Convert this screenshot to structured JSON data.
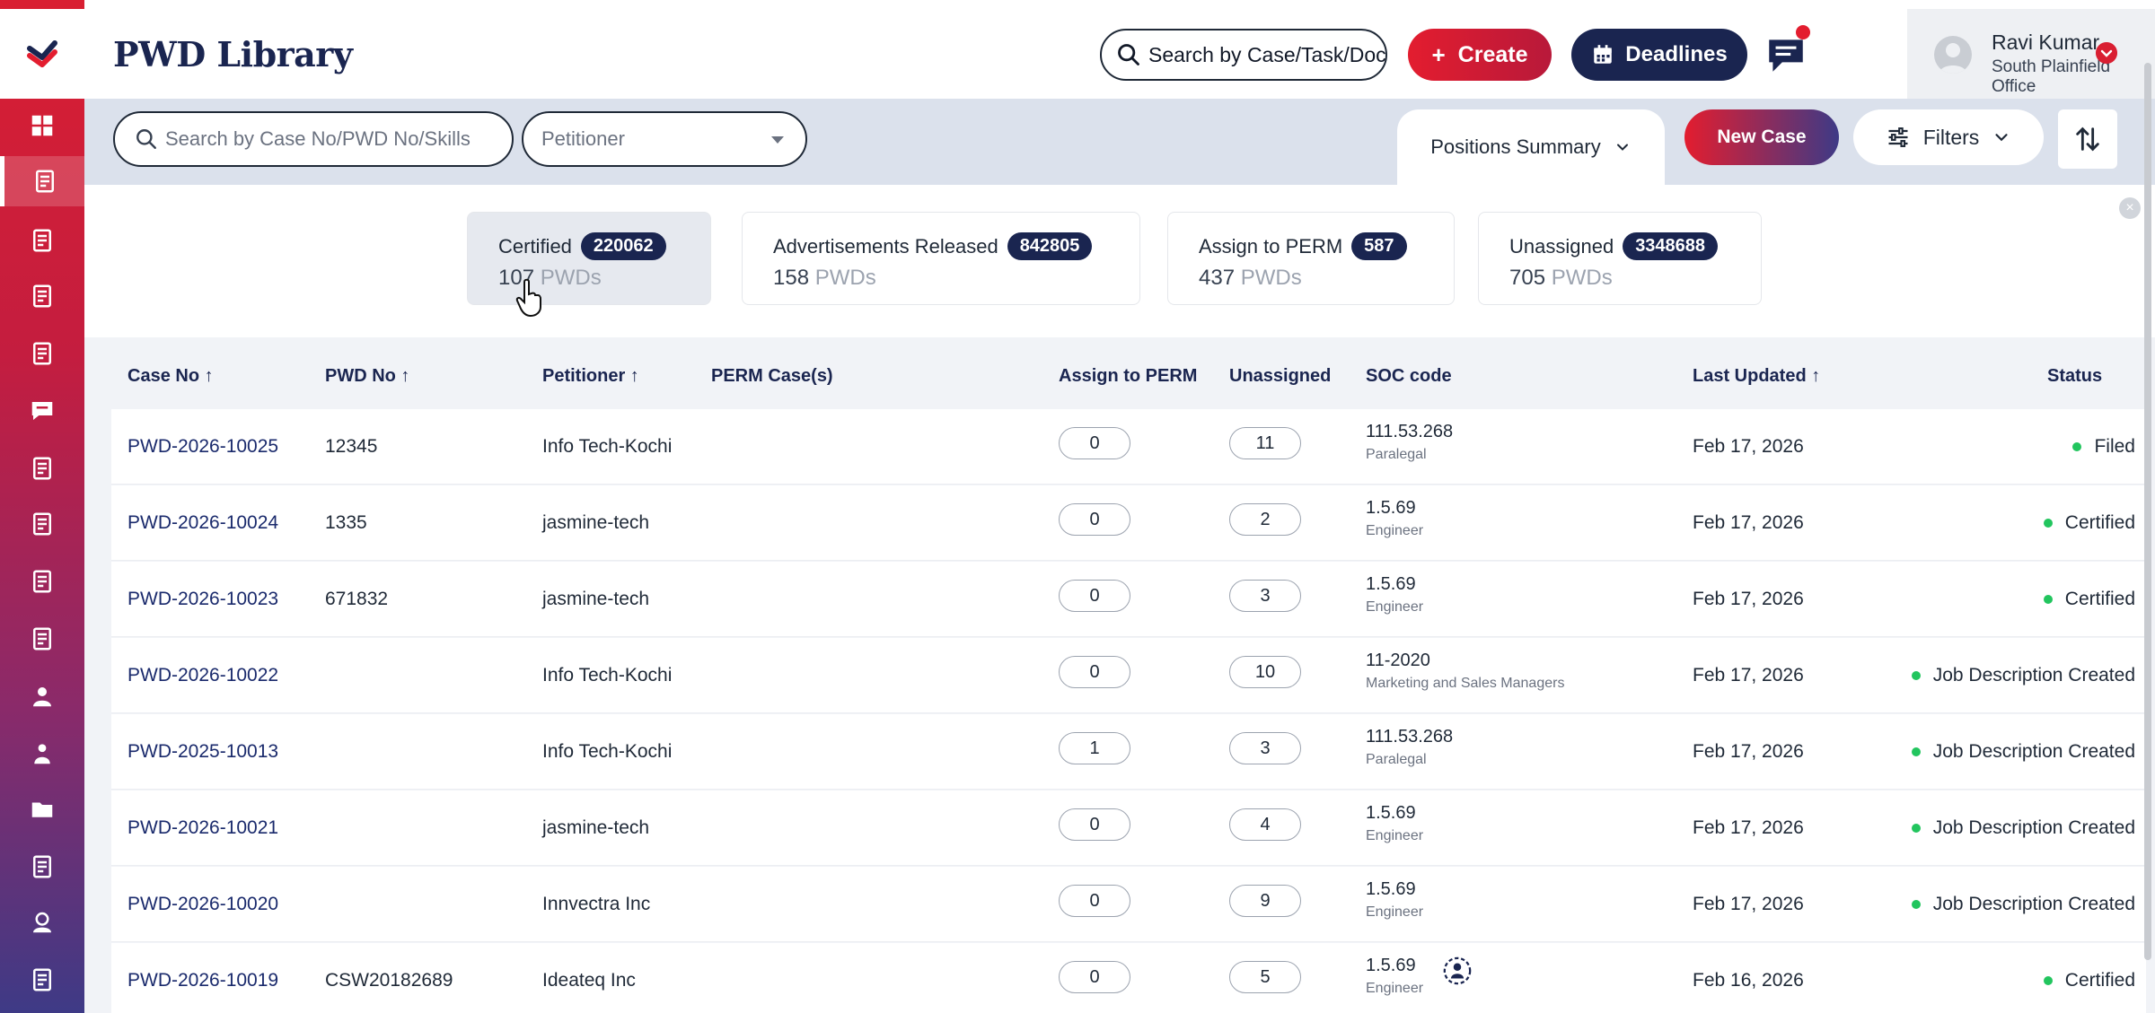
{
  "app": {
    "title": "PWD Library"
  },
  "header": {
    "search_placeholder": "Search by Case/Task/Docu",
    "create_label": "Create",
    "deadlines_label": "Deadlines",
    "user_name": "Ravi Kumar",
    "user_office": "South Plainfield Office"
  },
  "toolbar": {
    "case_search_placeholder": "Search by Case No/PWD No/Skills",
    "petitioner_placeholder": "Petitioner",
    "positions_tab_label": "Positions Summary",
    "new_case_label": "New Case",
    "filters_label": "Filters"
  },
  "summary": {
    "cards": [
      {
        "title": "Certified",
        "badge": "220062",
        "count": "107",
        "unit": "PWDs"
      },
      {
        "title": "Advertisements Released",
        "badge": "842805",
        "count": "158",
        "unit": "PWDs"
      },
      {
        "title": "Assign to PERM",
        "badge": "587",
        "count": "437",
        "unit": "PWDs"
      },
      {
        "title": "Unassigned",
        "badge": "3348688",
        "count": "705",
        "unit": "PWDs"
      }
    ]
  },
  "table": {
    "headers": {
      "case_no": "Case No ↑",
      "pwd_no": "PWD No ↑",
      "petitioner": "Petitioner ↑",
      "perm_cases": "PERM Case(s)",
      "assign_to_perm": "Assign to PERM",
      "unassigned": "Unassigned",
      "soc_code": "SOC code",
      "last_updated": "Last Updated ↑",
      "status": "Status"
    },
    "rows": [
      {
        "case_no": "PWD-2026-10025",
        "pwd_no": "12345",
        "petitioner": "Info Tech-Kochi",
        "assign": "0",
        "unassigned": "11",
        "soc_code": "111.53.268",
        "soc_desc": "Paralegal",
        "updated": "Feb 17, 2026",
        "status": "Filed"
      },
      {
        "case_no": "PWD-2026-10024",
        "pwd_no": "1335",
        "petitioner": "jasmine-tech",
        "assign": "0",
        "unassigned": "2",
        "soc_code": "1.5.69",
        "soc_desc": "Engineer",
        "updated": "Feb 17, 2026",
        "status": "Certified"
      },
      {
        "case_no": "PWD-2026-10023",
        "pwd_no": "671832",
        "petitioner": "jasmine-tech",
        "assign": "0",
        "unassigned": "3",
        "soc_code": "1.5.69",
        "soc_desc": "Engineer",
        "updated": "Feb 17, 2026",
        "status": "Certified"
      },
      {
        "case_no": "PWD-2026-10022",
        "pwd_no": "",
        "petitioner": "Info Tech-Kochi",
        "assign": "0",
        "unassigned": "10",
        "soc_code": "11-2020",
        "soc_desc": "Marketing and Sales Managers",
        "updated": "Feb 17, 2026",
        "status": "Job Description Created"
      },
      {
        "case_no": "PWD-2025-10013",
        "pwd_no": "",
        "petitioner": "Info Tech-Kochi",
        "assign": "1",
        "unassigned": "3",
        "soc_code": "111.53.268",
        "soc_desc": "Paralegal",
        "updated": "Feb 17, 2026",
        "status": "Job Description Created"
      },
      {
        "case_no": "PWD-2026-10021",
        "pwd_no": "",
        "petitioner": "jasmine-tech",
        "assign": "0",
        "unassigned": "4",
        "soc_code": "1.5.69",
        "soc_desc": "Engineer",
        "updated": "Feb 17, 2026",
        "status": "Job Description Created"
      },
      {
        "case_no": "PWD-2026-10020",
        "pwd_no": "",
        "petitioner": "Innvectra Inc",
        "assign": "0",
        "unassigned": "9",
        "soc_code": "1.5.69",
        "soc_desc": "Engineer",
        "updated": "Feb 17, 2026",
        "status": "Job Description Created"
      },
      {
        "case_no": "PWD-2026-10019",
        "pwd_no": "CSW20182689",
        "petitioner": "Ideateq Inc",
        "assign": "0",
        "unassigned": "5",
        "soc_code": "1.5.69",
        "soc_desc": "Engineer",
        "updated": "Feb 16, 2026",
        "status": "Certified"
      }
    ]
  },
  "sidebar": {
    "icons": [
      "dashboard-icon",
      "cases-icon",
      "document-check-icon",
      "document-dollar-icon",
      "document-approve-icon",
      "chat-icon",
      "ledger-icon",
      "edit-document-icon",
      "building-check-icon",
      "clipboard-icon",
      "user-icon",
      "team-icon",
      "folder-icon",
      "note-icon",
      "support-agent-icon",
      "receipt-icon"
    ],
    "active_index": 1
  },
  "colors": {
    "brand_red": "#e31d2f",
    "navy": "#1a2550",
    "status_green": "#22c55e"
  }
}
